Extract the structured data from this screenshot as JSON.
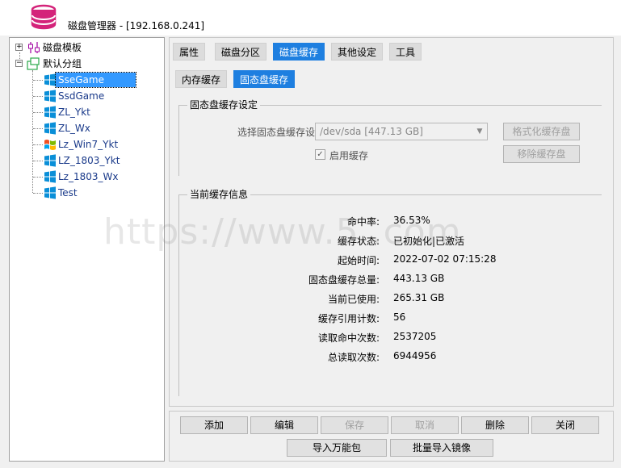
{
  "window": {
    "title": "磁盘管理器 - [192.168.0.241]"
  },
  "tree": {
    "root_template": "磁盘模板",
    "default_group": "默认分组",
    "items": [
      "SseGame",
      "SsdGame",
      "ZL_Ykt",
      "ZL_Wx",
      "Lz_Win7_Ykt",
      "LZ_1803_Ykt",
      "Lz_1803_Wx",
      "Test"
    ],
    "selected": "SseGame"
  },
  "tabs": [
    "属性",
    "磁盘分区",
    "磁盘缓存",
    "其他设定",
    "工具"
  ],
  "active_tab": "磁盘缓存",
  "subtabs": [
    "内存缓存",
    "固态盘缓存"
  ],
  "active_subtab": "固态盘缓存",
  "ssd_settings": {
    "group_title": "固态盘缓存设定",
    "select_label": "选择固态盘缓存设备:",
    "select_value": "/dev/sda [447.13 GB]",
    "format_button": "格式化缓存盘",
    "remove_button": "移除缓存盘",
    "enable_label": "启用缓存",
    "enable_checked": true
  },
  "cache_info": {
    "group_title": "当前缓存信息",
    "rows": [
      {
        "label": "命中率:",
        "value": "36.53%"
      },
      {
        "label": "缓存状态:",
        "value": "已初始化|已激活"
      },
      {
        "label": "起始时间:",
        "value": "2022-07-02  07:15:28"
      },
      {
        "label": "固态盘缓存总量:",
        "value": "443.13  GB"
      },
      {
        "label": "当前已使用:",
        "value": "265.31  GB"
      },
      {
        "label": "缓存引用计数:",
        "value": "56"
      },
      {
        "label": "读取命中次数:",
        "value": "2537205"
      },
      {
        "label": "总读取次数:",
        "value": "6944956"
      }
    ]
  },
  "bottom_buttons": {
    "add": "添加",
    "edit": "编辑",
    "save": "保存",
    "cancel": "取消",
    "delete": "删除",
    "close": "关闭",
    "import_pack": "导入万能包",
    "batch_import": "批量导入镜像"
  },
  "watermark": "https://www.5   .com",
  "colors": {
    "accent": "#1e7fe0",
    "selection": "#3399ff",
    "app_icon": "#d4237a"
  }
}
